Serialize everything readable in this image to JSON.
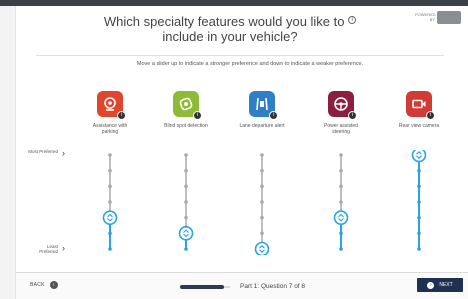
{
  "header": {
    "title_line1": "Which specialty features would you like to",
    "title_line2": "include in your vehicle?",
    "info_glyph": "i",
    "powered_by": "POWERED BY"
  },
  "instructions": "Move a slider up to indicate a stronger preference and down to indicate a weaker preference.",
  "axis": {
    "most": "Most Preferred",
    "least": "Least Preferred",
    "arrow": "›"
  },
  "features": [
    {
      "label": "Assistance with parking",
      "icon": "parking-assist-icon",
      "color": "#e0462c",
      "preference_level": 2,
      "levels": 7
    },
    {
      "label": "Blind spot detection",
      "icon": "blind-spot-icon",
      "color": "#8dbb37",
      "preference_level": 1,
      "levels": 7
    },
    {
      "label": "Lane departure alert",
      "icon": "lane-departure-icon",
      "color": "#2f7ec6",
      "preference_level": 0,
      "levels": 7
    },
    {
      "label": "Power assisted steering",
      "icon": "steering-wheel-icon",
      "color": "#8a1f3f",
      "preference_level": 2,
      "levels": 7
    },
    {
      "label": "Rear view camera",
      "icon": "camera-icon",
      "color": "#d23a35",
      "preference_level": 6,
      "levels": 7
    }
  ],
  "footer": {
    "back_label": "BACK",
    "progress_text": "Part 1: Question 7 of 8",
    "progress_fraction": 0.875,
    "next_label": "NEXT"
  },
  "colors": {
    "slider_active": "#2aa3e0",
    "slider_inactive": "#a9a9a9",
    "nav_dark": "#1f3050"
  }
}
